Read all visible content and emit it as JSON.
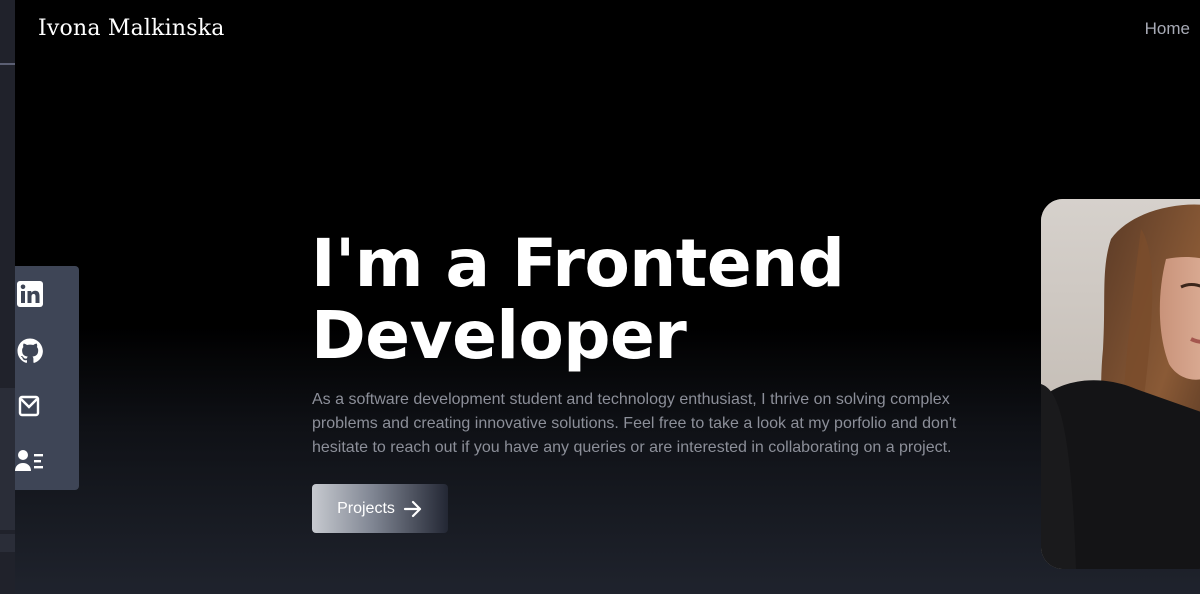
{
  "brand": {
    "name": "Ivona Malkinska"
  },
  "nav": {
    "home_label": "Home"
  },
  "social": {
    "items": [
      {
        "name": "linkedin-icon"
      },
      {
        "name": "github-icon"
      },
      {
        "name": "mail-icon"
      },
      {
        "name": "contact-card-icon"
      }
    ]
  },
  "hero": {
    "title_line1": "I'm a Frontend",
    "title_line2": "Developer",
    "description": "As a software development student and technology enthusiast, I thrive on solving complex problems and creating innovative solutions. Feel free to take a look at my porfolio and don't hesitate to reach out if you have any queries or are interested in collaborating on a project.",
    "cta_label": "Projects",
    "cta_icon": "arrow-right-icon"
  },
  "colors": {
    "background": "#000000",
    "sidebar": "#3e4556",
    "text_muted": "#8c8f99",
    "nav_text": "#a7aab5"
  }
}
